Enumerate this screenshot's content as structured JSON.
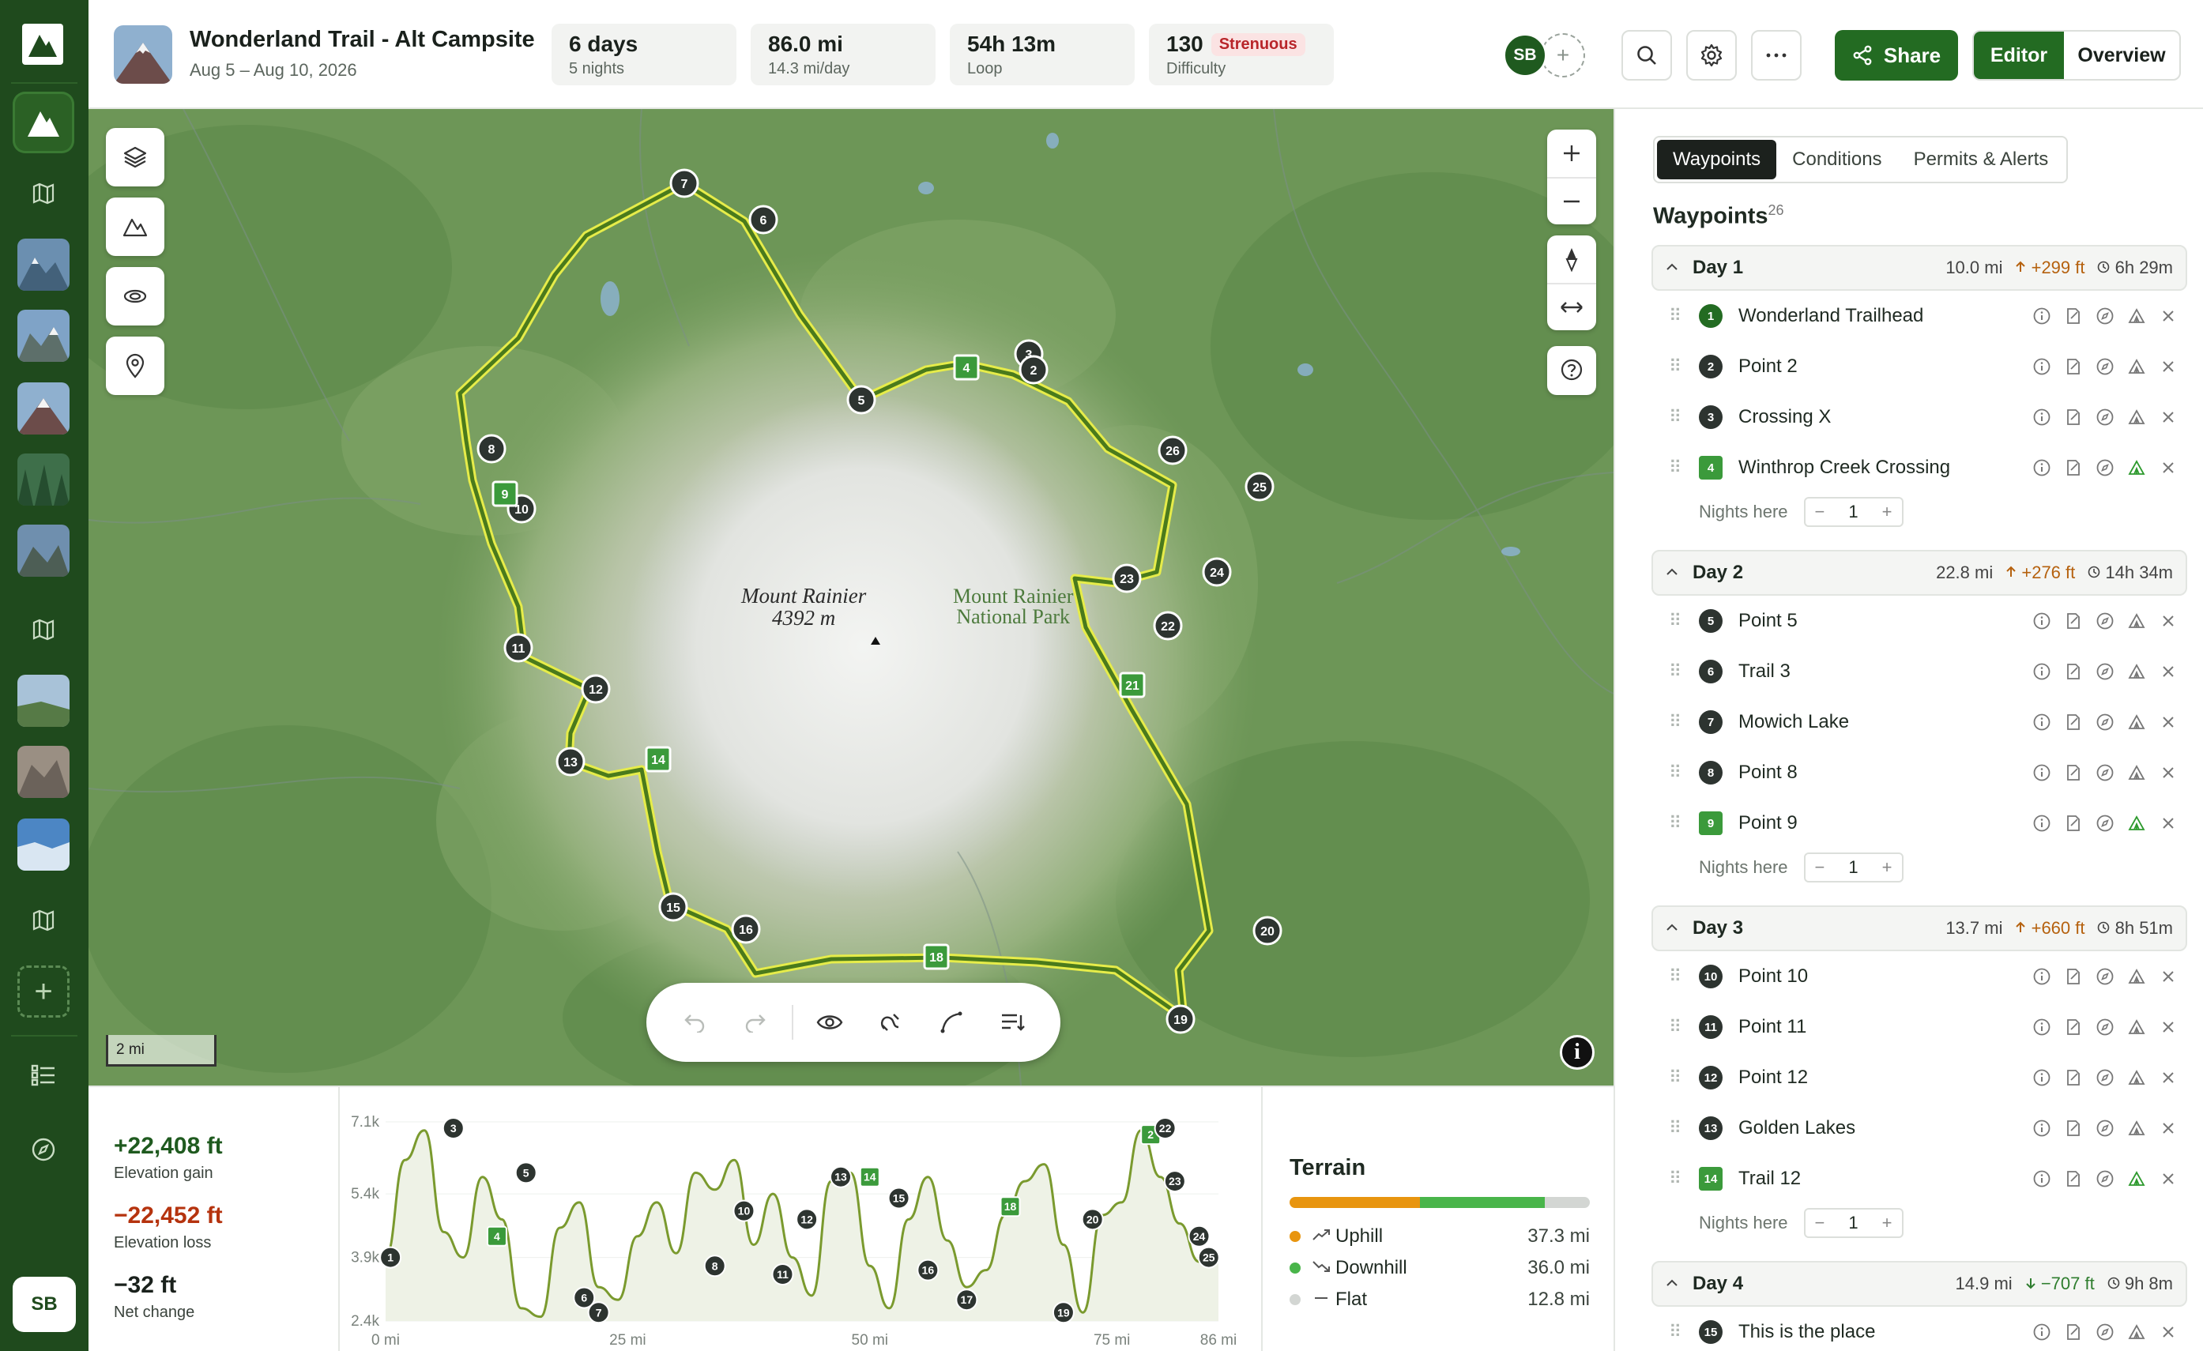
{
  "header": {
    "title": "Wonderland Trail - Alt Campsite",
    "dates": "Aug 5 – Aug 10, 2026",
    "stats": [
      {
        "main": "6 days",
        "sub": "5 nights"
      },
      {
        "main": "86.0 mi",
        "sub": "14.3 mi/day"
      },
      {
        "main": "54h 13m",
        "sub": "Loop"
      },
      {
        "main": "130",
        "badge": "Strenuous",
        "sub": "Difficulty"
      }
    ],
    "avatar": "SB",
    "add_member": "+",
    "share_label": "Share",
    "editor_label": "Editor",
    "overview_label": "Overview"
  },
  "rail": {
    "avatar": "SB",
    "add": "+"
  },
  "map": {
    "peak_name": "Mount Rainier",
    "peak_elev": "4392 m",
    "park_line1": "Mount Rainier",
    "park_line2": "National Park",
    "scale": "2 mi",
    "info": "i"
  },
  "elevation": {
    "gain": "+22,408 ft",
    "gain_label": "Elevation gain",
    "loss": "−22,452 ft",
    "loss_label": "Elevation loss",
    "net": "−32 ft",
    "net_label": "Net change"
  },
  "chart_data": {
    "type": "area",
    "y_ticks": [
      "7.1k",
      "5.4k",
      "3.9k",
      "2.4k"
    ],
    "x_ticks": [
      "0 mi",
      "25 mi",
      "50 mi",
      "75 mi",
      "86 mi"
    ],
    "ylim": [
      2400,
      7100
    ],
    "xlim": [
      0,
      86
    ],
    "x": [
      0,
      2,
      4,
      6,
      8,
      10,
      12,
      14,
      16,
      18,
      20,
      22,
      24,
      26,
      28,
      30,
      32,
      34,
      36,
      38,
      40,
      42,
      44,
      46,
      48,
      50,
      52,
      54,
      56,
      58,
      60,
      62,
      64,
      66,
      68,
      70,
      72,
      74,
      76,
      78,
      80,
      82,
      84,
      86
    ],
    "y": [
      3900,
      6200,
      6900,
      4500,
      3900,
      5800,
      4800,
      2700,
      2500,
      4600,
      5200,
      3200,
      2900,
      4400,
      5200,
      4000,
      5900,
      5500,
      6200,
      4200,
      5400,
      3900,
      3000,
      5700,
      5900,
      3700,
      2700,
      4800,
      5800,
      4300,
      3200,
      3600,
      4900,
      5700,
      6100,
      4200,
      2600,
      4900,
      5200,
      6900,
      5800,
      4700,
      3800,
      4000
    ],
    "waypoints": [
      {
        "label": "1",
        "x": 0.5,
        "y": 3900
      },
      {
        "label": "3",
        "x": 7,
        "y": 6950
      },
      {
        "label": "4",
        "x": 11.5,
        "y": 4400,
        "camp": true
      },
      {
        "label": "5",
        "x": 14.5,
        "y": 5900
      },
      {
        "label": "6",
        "x": 20.5,
        "y": 2950
      },
      {
        "label": "7",
        "x": 22,
        "y": 2600
      },
      {
        "label": "8",
        "x": 34,
        "y": 3700
      },
      {
        "label": "10",
        "x": 37,
        "y": 5000
      },
      {
        "label": "11",
        "x": 41,
        "y": 3500
      },
      {
        "label": "12",
        "x": 43.5,
        "y": 4800
      },
      {
        "label": "13",
        "x": 47,
        "y": 5800
      },
      {
        "label": "14",
        "x": 50,
        "y": 5800,
        "camp": true
      },
      {
        "label": "15",
        "x": 53,
        "y": 5300
      },
      {
        "label": "16",
        "x": 56,
        "y": 3600
      },
      {
        "label": "17",
        "x": 60,
        "y": 2900
      },
      {
        "label": "18",
        "x": 64.5,
        "y": 5100,
        "camp": true
      },
      {
        "label": "19",
        "x": 70,
        "y": 2600
      },
      {
        "label": "20",
        "x": 73,
        "y": 4800
      },
      {
        "label": "2",
        "x": 79,
        "y": 6800,
        "camp": true
      },
      {
        "label": "22",
        "x": 80.5,
        "y": 6950
      },
      {
        "label": "23",
        "x": 81.5,
        "y": 5700
      },
      {
        "label": "24",
        "x": 84,
        "y": 4400
      },
      {
        "label": "25",
        "x": 85,
        "y": 3900
      }
    ]
  },
  "terrain": {
    "title": "Terrain",
    "uphill_label": "Uphill",
    "uphill": "37.3 mi",
    "downhill_label": "Downhill",
    "downhill": "36.0 mi",
    "flat_label": "Flat",
    "flat": "12.8 mi",
    "colors": {
      "uphill": "#e8950f",
      "downhill": "#49b54a",
      "flat": "#d3d6d3"
    }
  },
  "panel": {
    "tabs": [
      "Waypoints",
      "Conditions",
      "Permits & Alerts"
    ],
    "heading": "Waypoints",
    "count": "26",
    "nights_label": "Nights here",
    "nights_value": "1",
    "minus": "−",
    "plus": "+",
    "days": [
      {
        "name": "Day 1",
        "dist": "10.0 mi",
        "gain": "+299 ft",
        "time": "6h 29m",
        "points": [
          {
            "n": "1",
            "name": "Wonderland Trailhead",
            "kind": "start"
          },
          {
            "n": "2",
            "name": "Point 2",
            "kind": "pt"
          },
          {
            "n": "3",
            "name": "Crossing X",
            "kind": "pt"
          },
          {
            "n": "4",
            "name": "Winthrop Creek Crossing",
            "kind": "camp"
          }
        ],
        "nights": true
      },
      {
        "name": "Day 2",
        "dist": "22.8 mi",
        "gain": "+276 ft",
        "time": "14h 34m",
        "points": [
          {
            "n": "5",
            "name": "Point 5",
            "kind": "pt"
          },
          {
            "n": "6",
            "name": "Trail 3",
            "kind": "pt"
          },
          {
            "n": "7",
            "name": "Mowich Lake",
            "kind": "pt"
          },
          {
            "n": "8",
            "name": "Point 8",
            "kind": "pt"
          },
          {
            "n": "9",
            "name": "Point 9",
            "kind": "camp"
          }
        ],
        "nights": true
      },
      {
        "name": "Day 3",
        "dist": "13.7 mi",
        "gain": "+660 ft",
        "time": "8h 51m",
        "points": [
          {
            "n": "10",
            "name": "Point 10",
            "kind": "pt"
          },
          {
            "n": "11",
            "name": "Point 11",
            "kind": "pt"
          },
          {
            "n": "12",
            "name": "Point 12",
            "kind": "pt"
          },
          {
            "n": "13",
            "name": "Golden Lakes",
            "kind": "pt"
          },
          {
            "n": "14",
            "name": "Trail 12",
            "kind": "camp"
          }
        ],
        "nights": true
      },
      {
        "name": "Day 4",
        "dist": "14.9 mi",
        "gain": "−707 ft",
        "down": true,
        "time": "9h 8m",
        "points": [
          {
            "n": "15",
            "name": "This is the place",
            "kind": "pt"
          }
        ],
        "nights": false
      }
    ]
  }
}
